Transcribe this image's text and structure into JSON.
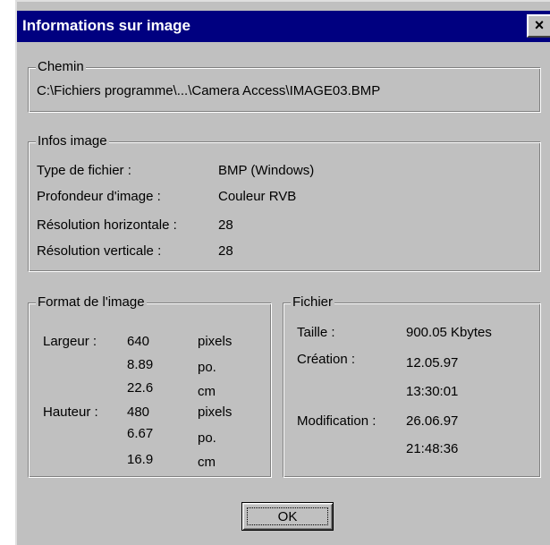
{
  "window": {
    "title": "Informations sur image",
    "close_glyph": "×",
    "close_icon": "close-icon"
  },
  "chemin": {
    "legend": "Chemin",
    "path": "C:\\Fichiers programme\\...\\Camera Access\\IMAGE03.BMP"
  },
  "infos": {
    "legend": "Infos image",
    "rows": [
      {
        "label": "Type de fichier :",
        "value": "BMP (Windows)"
      },
      {
        "label": "Profondeur d'image :",
        "value": "Couleur RVB"
      },
      {
        "label": "Résolution horizontale :",
        "value": "28"
      },
      {
        "label": "Résolution verticale :",
        "value": "28"
      }
    ]
  },
  "format": {
    "legend": "Format de l'image",
    "largeur_label": "Largeur :",
    "hauteur_label": "Hauteur :",
    "largeur": [
      {
        "value": "640",
        "unit": "pixels"
      },
      {
        "value": "8.89",
        "unit": "po."
      },
      {
        "value": "22.6",
        "unit": "cm"
      }
    ],
    "hauteur": [
      {
        "value": "480",
        "unit": "pixels"
      },
      {
        "value": "6.67",
        "unit": "po."
      },
      {
        "value": "16.9",
        "unit": "cm"
      }
    ]
  },
  "fichier": {
    "legend": "Fichier",
    "taille_label": "Taille :",
    "taille_value": "900.05 Kbytes",
    "creation_label": "Création :",
    "creation_date": "12.05.97",
    "creation_time": "13:30:01",
    "modification_label": "Modification :",
    "modification_date": "26.06.97",
    "modification_time": "21:48:36"
  },
  "buttons": {
    "ok_label": "OK"
  },
  "colors": {
    "titlebar": "#000080",
    "face": "#c0c0c0"
  }
}
